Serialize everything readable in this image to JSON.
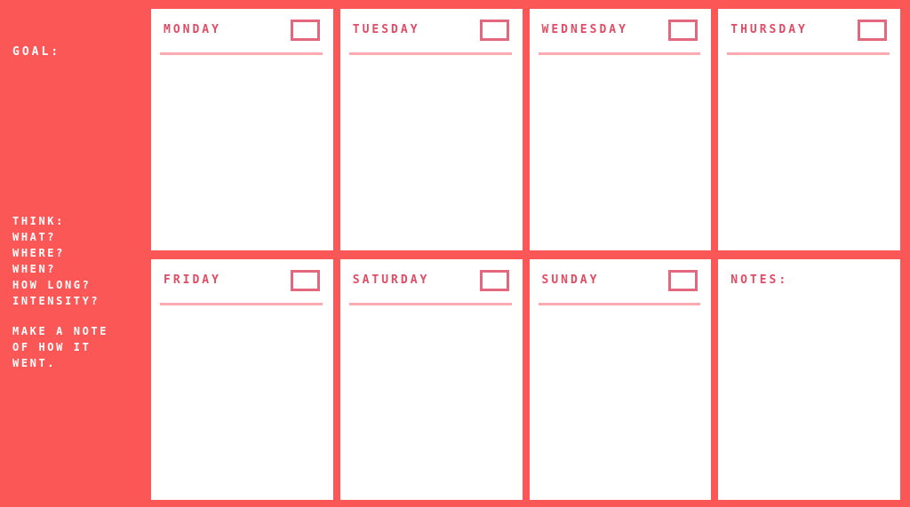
{
  "theme": {
    "background_red": "#fb5757",
    "card_background": "#ffffff",
    "title_rose": "#df4c63",
    "checkbox_border": "#e3687d",
    "rule_pink": "#ffa9b1",
    "sidebar_text": "#ffffff"
  },
  "sidebar": {
    "goal_label": "GOAL:",
    "think_lines": [
      "THINK:",
      "WHAT?",
      "WHERE?",
      "WHEN?",
      "HOW LONG?",
      "INTENSITY?"
    ],
    "note_lines": [
      "MAKE A NOTE",
      "OF HOW IT",
      "WENT."
    ]
  },
  "cards": [
    {
      "title": "MONDAY",
      "has_checkbox": true,
      "has_rule": true,
      "checked": false
    },
    {
      "title": "TUESDAY",
      "has_checkbox": true,
      "has_rule": true,
      "checked": false
    },
    {
      "title": "WEDNESDAY",
      "has_checkbox": true,
      "has_rule": true,
      "checked": false
    },
    {
      "title": "THURSDAY",
      "has_checkbox": true,
      "has_rule": true,
      "checked": false
    },
    {
      "title": "FRIDAY",
      "has_checkbox": true,
      "has_rule": true,
      "checked": false
    },
    {
      "title": "SATURDAY",
      "has_checkbox": true,
      "has_rule": true,
      "checked": false
    },
    {
      "title": "SUNDAY",
      "has_checkbox": true,
      "has_rule": true,
      "checked": false
    },
    {
      "title": "NOTES:",
      "has_checkbox": false,
      "has_rule": false,
      "checked": false
    }
  ]
}
